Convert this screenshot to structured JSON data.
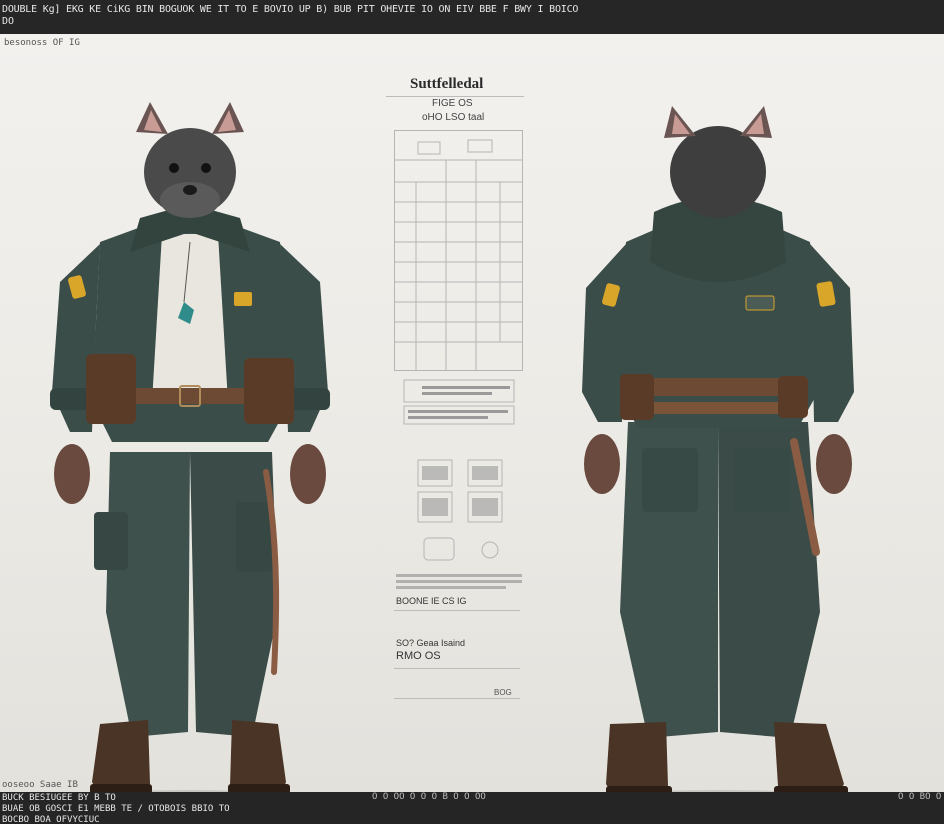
{
  "header": {
    "line1": "DOUBLE Kg] EKG KE CiKG BIN BOGUOK WE IT TO E BOVIO UP B) BUB PIT OHEVIE IO ON EIV BBE F BWY I BOICO",
    "line2": "DO"
  },
  "sheet": {
    "subtitle": "besonoss OF IG"
  },
  "spec": {
    "title": "Suttfelledal",
    "line2": "FIGE OS",
    "line3": "oHO LSO taal",
    "notes": [
      "BOONE IE CS IG",
      "SO? Geaa Isaind",
      "RMO OS",
      "BOG"
    ]
  },
  "footer": {
    "line0": "ooseoo Saae IB",
    "line1": "BUCK BESIUGEE BY B TO",
    "line2": "BUAE OB GOSCI E1 MEBB TE / OTOBOIS BBIO TO",
    "line3": "BOCBO BOA OFVYCIUC",
    "mid": "O O OO O O O B O O OO",
    "right": "O O BO O"
  },
  "colors": {
    "jacket": "#3b4d48",
    "pants": "#3f514d",
    "fur": "#4a4a4a",
    "boots": "#4a3426",
    "belt": "#6d4a33",
    "shirt": "#e9e6df",
    "patch": "#d9a62a"
  }
}
